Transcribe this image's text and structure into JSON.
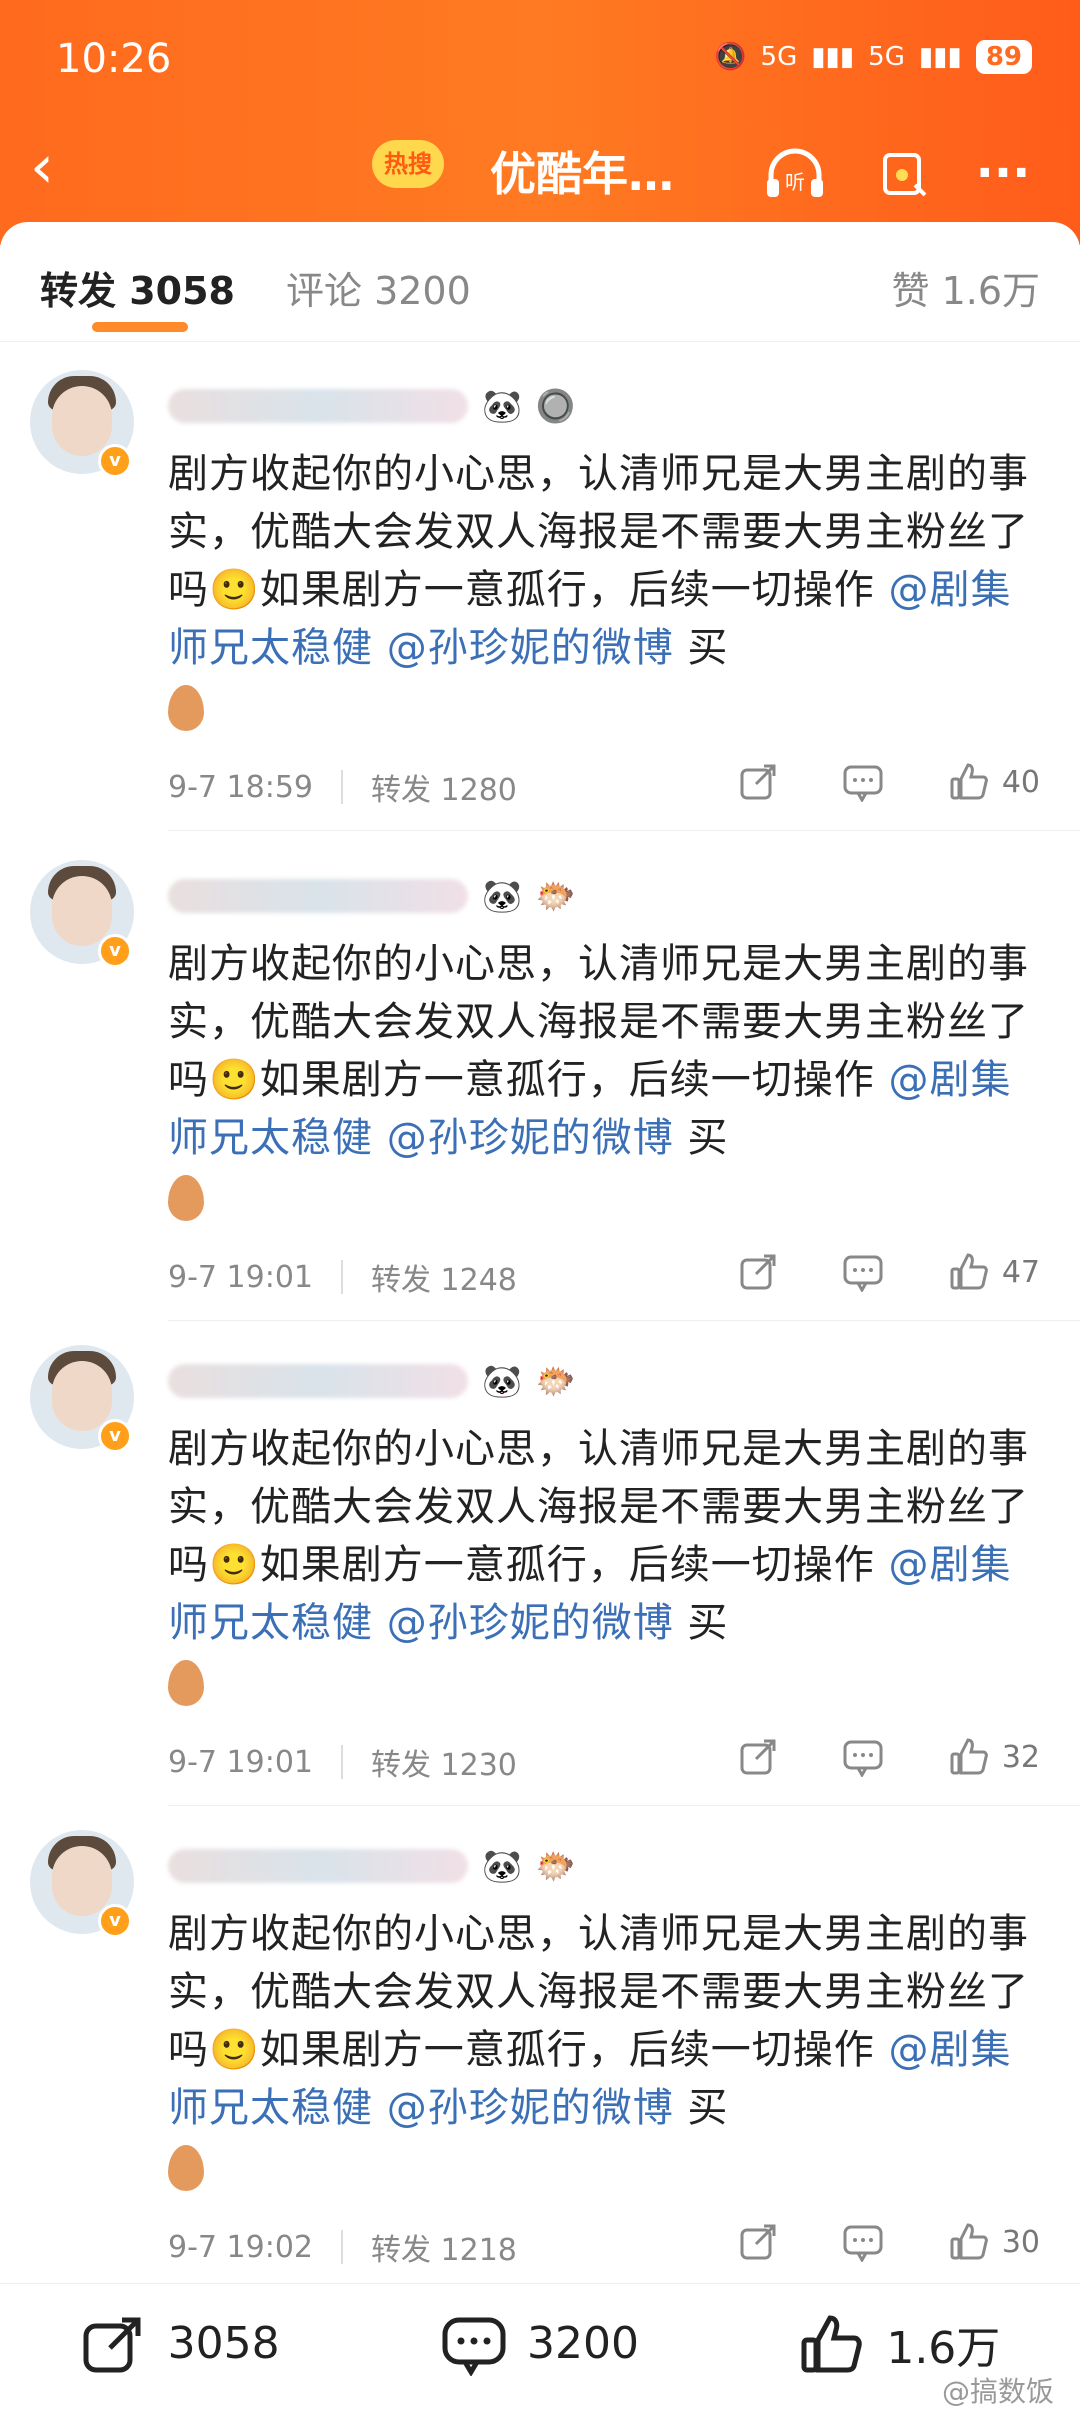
{
  "status": {
    "time": "10:26",
    "network1": "5G",
    "network2": "5G",
    "battery": "89"
  },
  "nav": {
    "hot_badge": "热搜",
    "title": "优酷年…",
    "listen_label": "听"
  },
  "tabs": {
    "repost": "转发 3058",
    "comment": "评论 3200",
    "likes": "赞 1.6万"
  },
  "comments": [
    {
      "body_main": "剧方收起你的小心思，认清师兄是大男主剧的事实，优酷大会发双人海报是不需要大男主粉丝了吗🙂如果剧方一意孤行，后续一切操作 ",
      "mention1": "@剧集师兄太稳健",
      "mention2": "@孙珍妮的微博",
      "tail": " 买",
      "time": "9-7 18:59",
      "reposts": "转发 1280",
      "likes": "40",
      "badges": [
        "🐼",
        "🔘"
      ]
    },
    {
      "body_main": "剧方收起你的小心思，认清师兄是大男主剧的事实，优酷大会发双人海报是不需要大男主粉丝了吗🙂如果剧方一意孤行，后续一切操作 ",
      "mention1": "@剧集师兄太稳健",
      "mention2": "@孙珍妮的微博",
      "tail": " 买",
      "time": "9-7 19:01",
      "reposts": "转发 1248",
      "likes": "47",
      "badges": [
        "🐼",
        "🐡"
      ]
    },
    {
      "body_main": "剧方收起你的小心思，认清师兄是大男主剧的事实，优酷大会发双人海报是不需要大男主粉丝了吗🙂如果剧方一意孤行，后续一切操作 ",
      "mention1": "@剧集师兄太稳健",
      "mention2": "@孙珍妮的微博",
      "tail": " 买",
      "time": "9-7 19:01",
      "reposts": "转发 1230",
      "likes": "32",
      "badges": [
        "🐼",
        "🐡"
      ]
    },
    {
      "body_main": "剧方收起你的小心思，认清师兄是大男主剧的事实，优酷大会发双人海报是不需要大男主粉丝了吗🙂如果剧方一意孤行，后续一切操作 ",
      "mention1": "@剧集师兄太稳健",
      "mention2": "@孙珍妮的微博",
      "tail": " 买",
      "time": "9-7 19:02",
      "reposts": "转发 1218",
      "likes": "30",
      "badges": [
        "🐼",
        "🐡"
      ]
    }
  ],
  "bottom": {
    "reposts": "3058",
    "comments": "3200",
    "likes": "1.6万"
  },
  "watermark": "@搞数饭",
  "colors": {
    "accent": "#ff6a1e",
    "mention": "#3b6fb6",
    "badge": "#ff9f1a"
  }
}
